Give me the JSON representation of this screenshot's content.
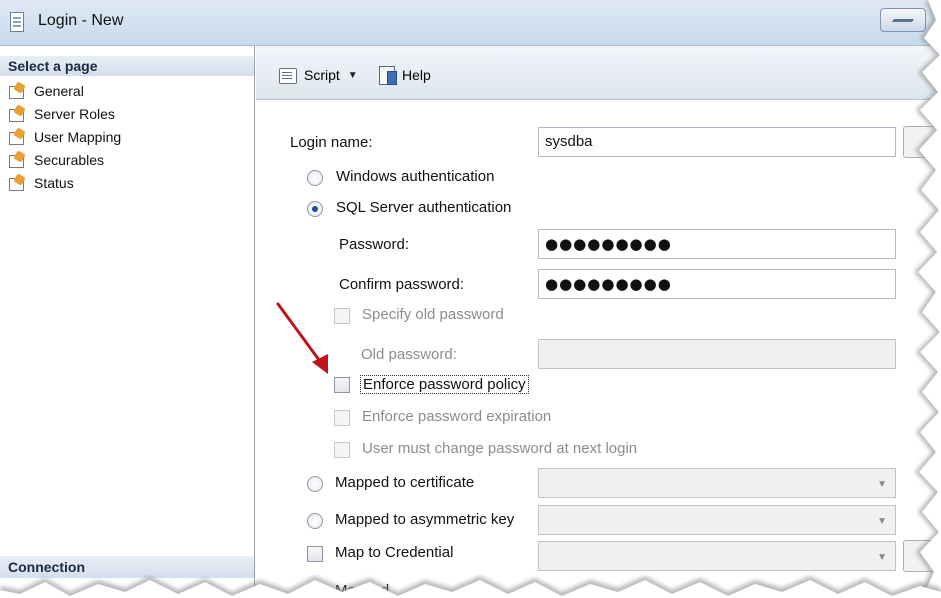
{
  "window": {
    "title": "Login - New"
  },
  "sidebar": {
    "header": "Select a page",
    "items": [
      {
        "label": "General"
      },
      {
        "label": "Server Roles"
      },
      {
        "label": "User Mapping"
      },
      {
        "label": "Securables"
      },
      {
        "label": "Status"
      }
    ],
    "connection_header": "Connection"
  },
  "toolbar": {
    "script_label": "Script",
    "help_label": "Help"
  },
  "form": {
    "login_name_label": "Login name:",
    "login_name_value": "sysdba",
    "windows_auth_label": "Windows authentication",
    "sql_auth_label": "SQL Server authentication",
    "password_label": "Password:",
    "password_value": "●●●●●●●●●",
    "confirm_password_label": "Confirm password:",
    "confirm_password_value": "●●●●●●●●●",
    "specify_old_password_label": "Specify old password",
    "old_password_label": "Old password:",
    "enforce_policy_label": "Enforce password policy",
    "enforce_expiration_label": "Enforce password expiration",
    "must_change_label": "User must change password at next login",
    "mapped_certificate_label": "Mapped to certificate",
    "mapped_asym_key_label": "Mapped to asymmetric key",
    "map_credential_label": "Map to Credential",
    "mapped_credentials_label": "Mapped"
  },
  "colors": {
    "annotation_arrow": "#c0141c"
  }
}
